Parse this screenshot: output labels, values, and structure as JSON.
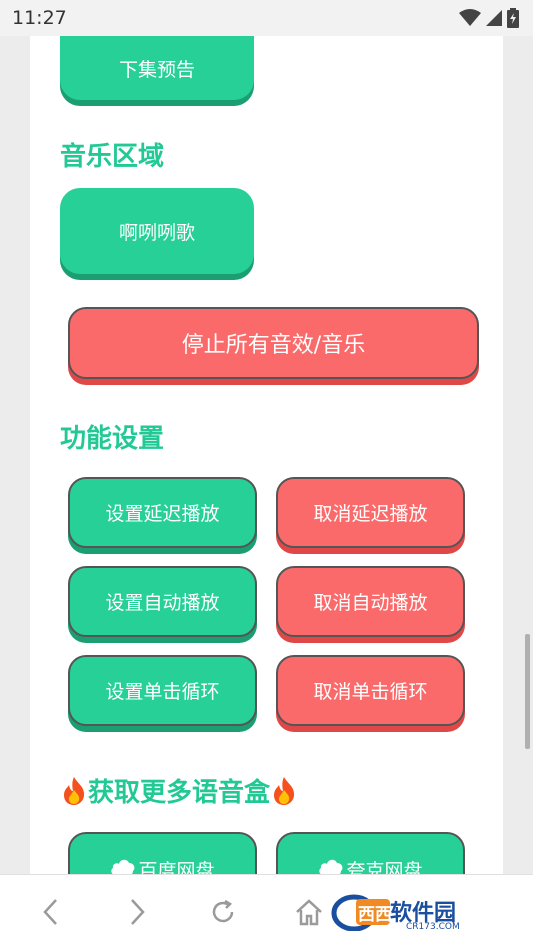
{
  "status_bar": {
    "time": "11:27"
  },
  "sections": {
    "prev": {
      "button": "下集预告"
    },
    "music": {
      "title": "音乐区域",
      "button": "啊咧咧歌"
    },
    "stop_all": {
      "label": "停止所有音效/音乐"
    },
    "settings": {
      "title": "功能设置",
      "set_delay": "设置延迟播放",
      "cancel_delay": "取消延迟播放",
      "set_auto": "设置自动播放",
      "cancel_auto": "取消自动播放",
      "set_loop": "设置单击循环",
      "cancel_loop": "取消单击循环"
    },
    "more": {
      "title": "获取更多语音盒",
      "baidu": "百度网盘",
      "quark": "夸克网盘"
    }
  },
  "watermark": {
    "text": "软件园",
    "sub": "CR173.COM"
  },
  "colors": {
    "green": "#27d096",
    "red": "#fb6a6a",
    "heading": "#22c995"
  }
}
